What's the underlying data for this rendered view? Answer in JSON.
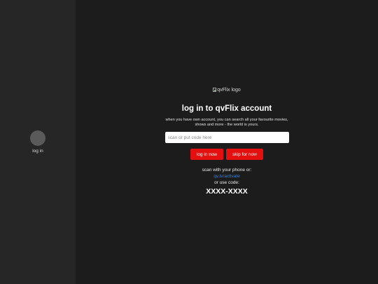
{
  "sidebar": {
    "profile_label": "log in"
  },
  "login": {
    "logo_alt": "qvFlix logo",
    "title": "log in to qvFlix account",
    "subtitle": "when you have own account, you can search all your favourite movies, shows and more - the world is yours.",
    "input_placeholder": "scan or put code here",
    "input_value": "",
    "login_button": "log in now",
    "skip_button": "skip for now",
    "scan_label": "scan with your phone or:",
    "activate_link": "qv.tv/activate",
    "code_label": "or use code:",
    "code_value": "XXXX-XXXX"
  },
  "colors": {
    "background": "#1c1c1c",
    "sidebar": "#262626",
    "accent": "#e40f0f",
    "link": "#3b7fd6"
  }
}
